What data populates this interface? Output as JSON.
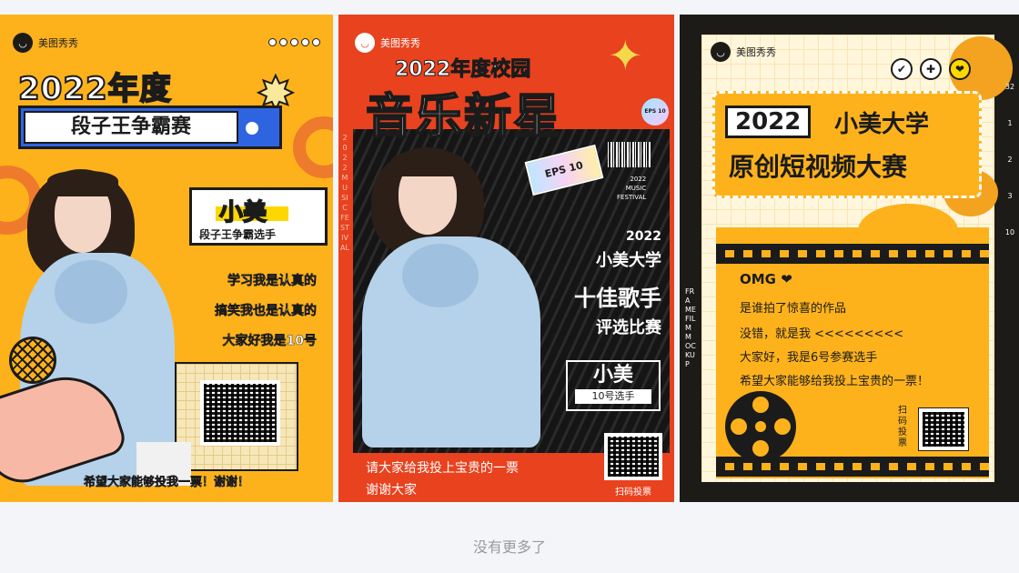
{
  "cards": [
    {
      "brand": "美图秀秀",
      "title_line1": "2022年度",
      "title_line2": "段子王争霸赛",
      "name": "小美",
      "name_subtitle": "段子王争霸选手",
      "lines": [
        "学习我是认真的",
        "搞笑我也是认真的",
        "大家好我是10号"
      ],
      "bottom": "希望大家能够投我一票！谢谢！"
    },
    {
      "brand": "美图秀秀",
      "title_line1": "2022年度校园",
      "title_line2": "音乐新星",
      "side_text": "2022 MUSIC FESTIVAL",
      "sticker": "EPS 10",
      "eps_badge": "EPS 10",
      "festival": [
        "2022",
        "MUSIC",
        "FESTIVAL"
      ],
      "right_lines": [
        "2022",
        "小美大学",
        "十佳歌手",
        "评选比赛"
      ],
      "name": "小美",
      "name_subtitle": "10号选手",
      "footer1": "请大家给我投上宝贵的一票",
      "footer2": "谢谢大家",
      "qr_label": "扫码投票"
    },
    {
      "brand": "美图秀秀",
      "year": "2022",
      "title_a": "小美大学",
      "title_b": "原创短视频大赛",
      "icons": [
        "✔",
        "✚",
        "❤"
      ],
      "omg": "OMG ❤",
      "lines": [
        "是谁拍了惊喜的作品",
        "没错，就是我 <<<<<<<<<",
        "大家好，我是6号参赛选手",
        "希望大家能够给我投上宝贵的一票！"
      ],
      "qr_label": "扫码投票",
      "vertical_text": "FRAME FILM MOCKUP",
      "edge_numbers": [
        "32",
        "1",
        "2",
        "3",
        "10"
      ]
    }
  ],
  "footer": "没有更多了",
  "colors": {
    "card1_bg": "#fdb21c",
    "card2_bg": "#e8421f",
    "card3_bg": "#1d1b17",
    "accent_blue": "#2e64e0"
  }
}
